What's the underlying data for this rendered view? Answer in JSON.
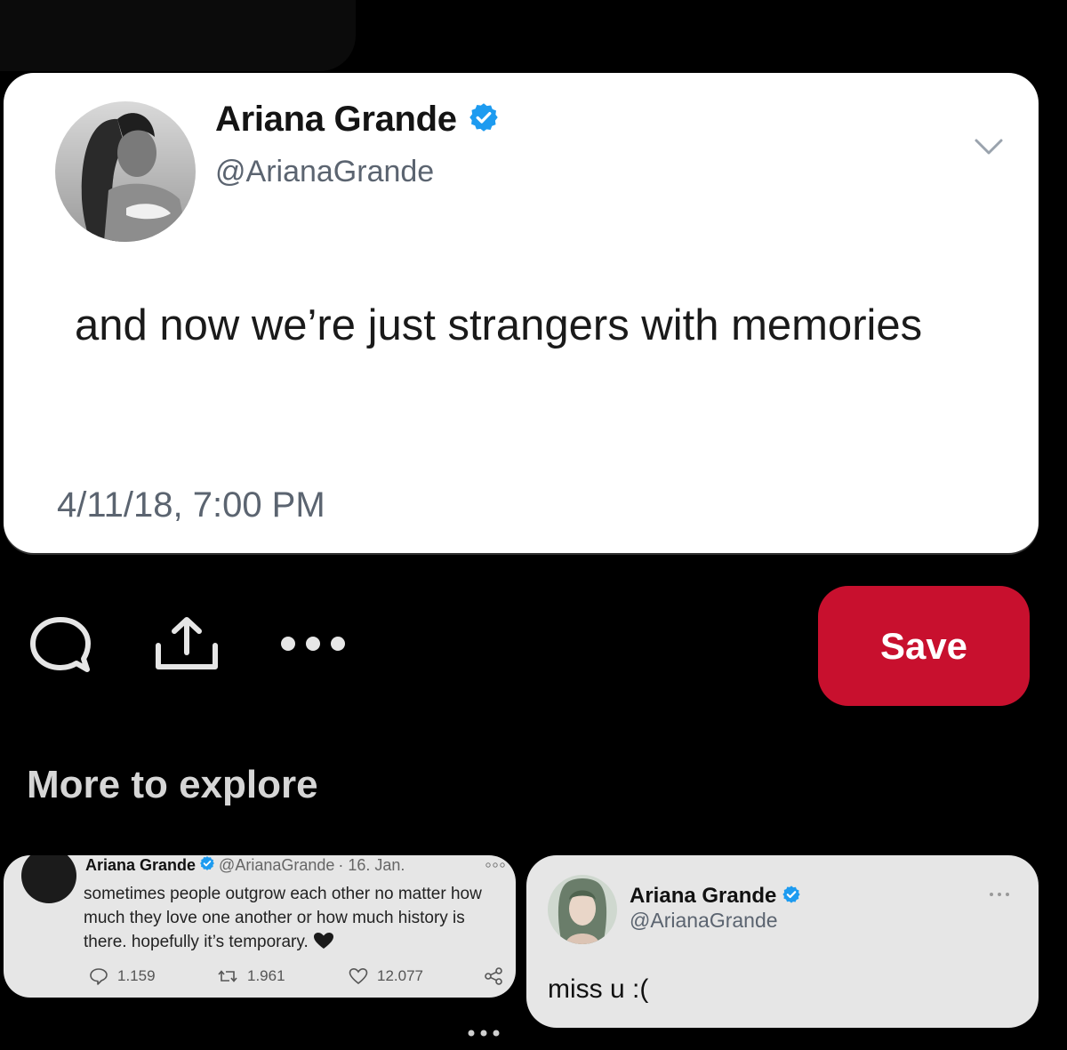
{
  "tweet": {
    "name": "Ariana Grande",
    "handle": "@ArianaGrande",
    "text": "and now we’re just strangers with memories",
    "date": "4/11/18, 7:00 PM",
    "icons": [
      "verified-badge-icon",
      "chevron-down-icon"
    ]
  },
  "actions": {
    "icons": [
      "comment-icon",
      "share-icon",
      "more-options-icon"
    ],
    "save_label": "Save"
  },
  "section_title": "More to explore",
  "explore": [
    {
      "name": "Ariana Grande",
      "handle": "@ArianaGrande",
      "date": "· 16. Jan.",
      "text": "sometimes people outgrow each other no matter how much they love one another or how much history is there. hopefully it’s temporary.",
      "replies": "1.159",
      "retweets": "1.961",
      "likes": "12.077"
    },
    {
      "name": "Ariana Grande",
      "handle": "@ArianaGrande",
      "text": "miss u :("
    }
  ],
  "colors": {
    "background": "#000000",
    "card": "#ffffff",
    "save_button": "#c8102e",
    "verified": "#1d9bf0",
    "explore_card": "#e6e6e6"
  }
}
